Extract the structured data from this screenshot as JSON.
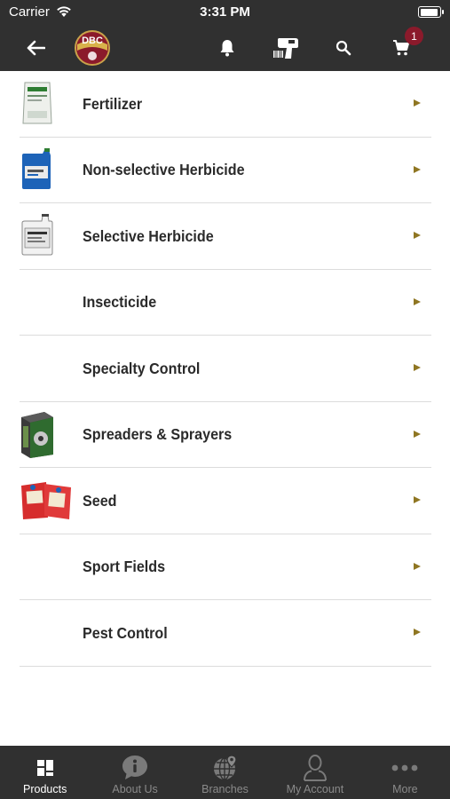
{
  "status_bar": {
    "carrier": "Carrier",
    "time": "3:31 PM",
    "battery_level": 0.95
  },
  "header": {
    "icons": [
      "back-arrow-icon",
      "dbc-logo",
      "bell-icon",
      "barcode-scanner-icon",
      "search-icon",
      "cart-icon"
    ],
    "cart_count": "1",
    "logo_text": "DBC",
    "brand_color": "#8b1a2b"
  },
  "categories": [
    {
      "label": "Fertilizer",
      "image": "fertilizer-bag"
    },
    {
      "label": "Non-selective Herbicide",
      "image": "herbicide-jug-blue"
    },
    {
      "label": "Selective Herbicide",
      "image": "herbicide-jug-white"
    },
    {
      "label": "Insecticide",
      "image": ""
    },
    {
      "label": "Specialty Control",
      "image": ""
    },
    {
      "label": "Spreaders & Sprayers",
      "image": "spreader-box"
    },
    {
      "label": "Seed",
      "image": "seed-bags"
    },
    {
      "label": "Sport Fields",
      "image": ""
    },
    {
      "label": "Pest Control",
      "image": ""
    }
  ],
  "tabbar": {
    "tabs": [
      {
        "label": "Products",
        "icon": "grid-icon",
        "active": true
      },
      {
        "label": "About Us",
        "icon": "info-icon",
        "active": false
      },
      {
        "label": "Branches",
        "icon": "globe-pin-icon",
        "active": false
      },
      {
        "label": "My Account",
        "icon": "person-icon",
        "active": false
      },
      {
        "label": "More",
        "icon": "more-dots-icon",
        "active": false
      }
    ]
  },
  "colors": {
    "bar_bg": "#303030",
    "chevron": "#8f7622",
    "badge": "#8b1a2b"
  }
}
